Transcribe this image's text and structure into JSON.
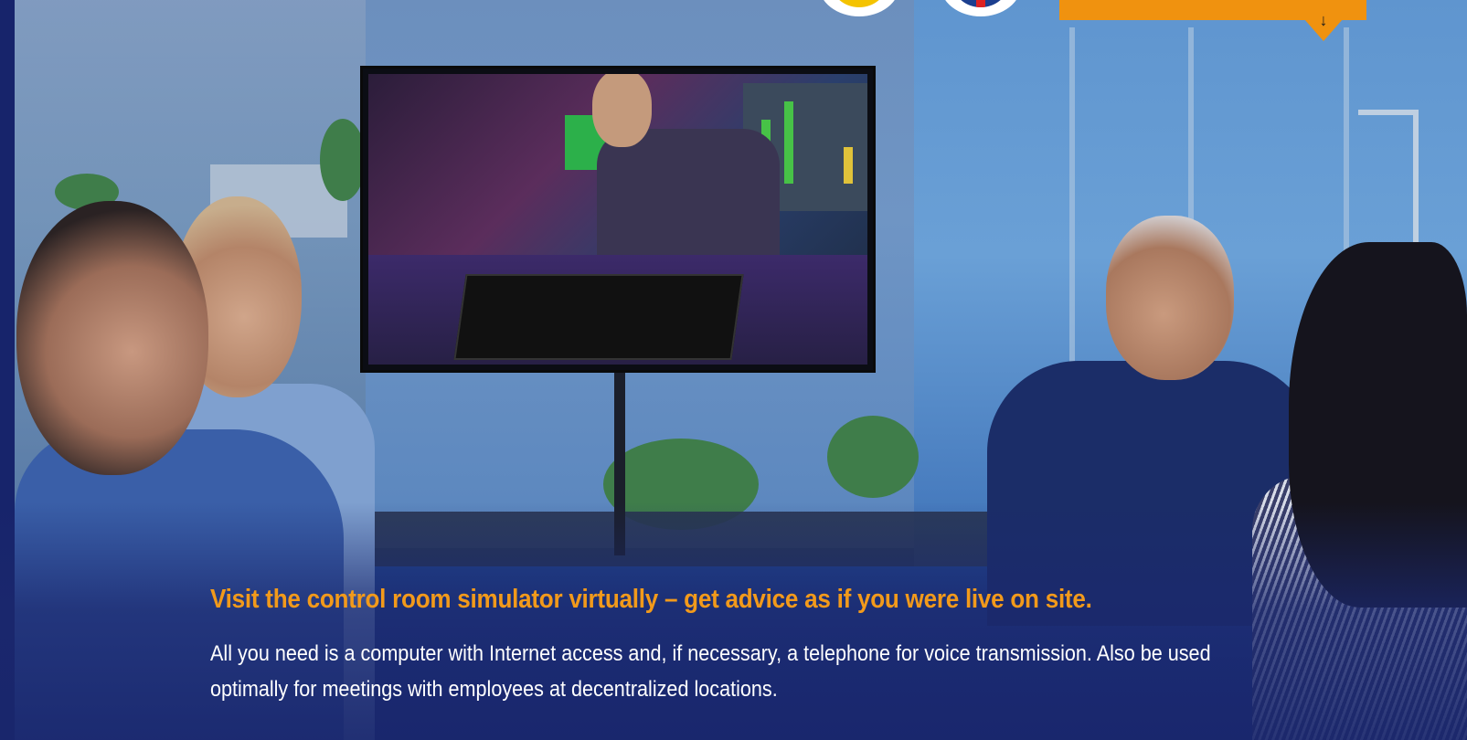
{
  "hero": {
    "headline": "Visit the control room simulator virtually – get advice as if you were live on site.",
    "body": "All you need is a computer with Internet access and, if necessary, a telephone for voice transmission. Also be used optimally for meetings with employees at decentralized locations."
  },
  "header": {
    "cta_arrow_icon": "arrow-down-icon",
    "cta_color": "#f0920f",
    "badges": [
      {
        "name": "yellow-language-badge",
        "color": "#f4c300"
      },
      {
        "name": "uk-flag-language-badge",
        "color": "#1c3f8f"
      }
    ]
  },
  "colors": {
    "headline": "#f29a1b",
    "body_text": "#ffffff",
    "overlay": "#1b286e"
  }
}
